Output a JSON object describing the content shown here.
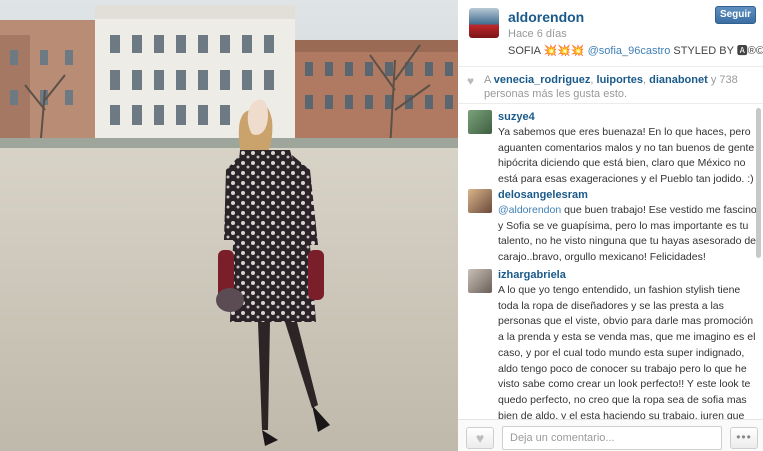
{
  "post": {
    "username": "aldorendon",
    "time": "Hace 6 días",
    "caption_prefix": "SOFIA",
    "caption_emoji": "💥💥💥",
    "caption_mention": "@sofia_96castro",
    "caption_suffix": "STYLED BY 🅰®©",
    "follow_label": "Seguir"
  },
  "likes": {
    "prefix": "A",
    "users": [
      "venecia_rodriguez",
      "luiportes",
      "dianabonet"
    ],
    "sep1": ",",
    "sep2": ",",
    "suffix_a": "y 738",
    "suffix_b": "personas más les gusta esto."
  },
  "comments": [
    {
      "user": "suzye4",
      "text": "Ya sabemos que eres buenaza! En lo que haces, pero aguanten comentarios malos y no tan buenos de gente hipócrita diciendo que está bien, claro que México no está para esas exageraciones y el Pueblo tan jodido. :)"
    },
    {
      "user": "delosangelesram",
      "mention": "@aldorendon",
      "text": " que buen trabajo! Ese vestido me fascino y Sofia se ve guapísima, pero lo mas importante es tu talento, no he visto ninguna que tu hayas asesorado del carajo..bravo, orgullo mexicano! Felicidades!"
    },
    {
      "user": "izhargabriela",
      "text": "A lo que yo tengo entendido, un fashion stylish tiene toda la ropa de diseñadores y se las presta a las personas que el viste, obvio para darle mas promoción a la prenda y esta se venda mas, que me imagino es el caso, y por el cual todo mundo esta super indignado, aldo tengo poco de conocer su trabajo pero lo que he visto sabe como crear un look perfecto!! Y este look te quedo perfecto, no creo que la ropa sea de sofia mas bien de aldo, y el esta haciendo su trabajo, juren que ese"
    }
  ],
  "footer": {
    "comment_placeholder": "Deja un comentario...",
    "more_label": "•••"
  },
  "icons": {
    "heart": "♥"
  },
  "colors": {
    "link": "#1a5a8a",
    "button": "#3b6ea2"
  }
}
